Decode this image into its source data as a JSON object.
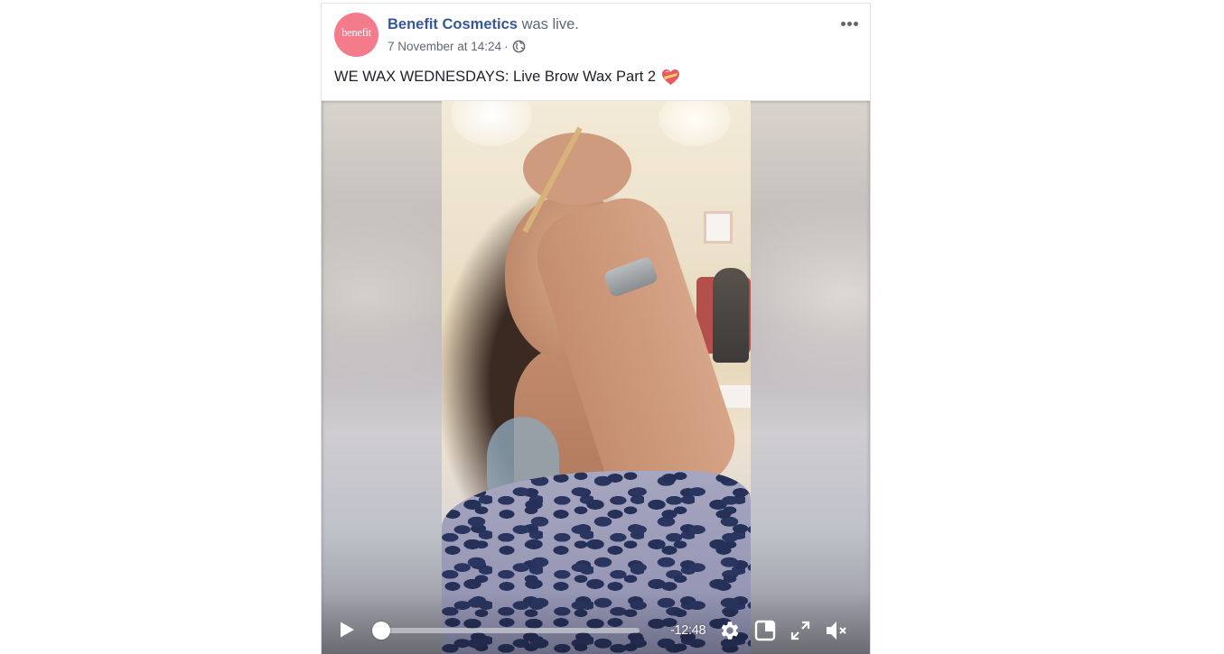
{
  "post": {
    "page_name": "Benefit Cosmetics",
    "action": "was live.",
    "timestamp": "7 November at 14:24",
    "separator": "·",
    "audience_icon": "globe-icon",
    "message": "WE WAX WEDNESDAYS: Live Brow Wax Part 2",
    "message_emoji": "heart-with-ribbon-icon",
    "avatar_logo": "benefit",
    "avatar_color": "#f47b8a",
    "link_color": "#365899"
  },
  "video": {
    "time_remaining": "-12:48",
    "progress_fraction": 0.0,
    "controls": [
      "play-icon",
      "gear-icon",
      "picture-in-picture-icon",
      "fullscreen-icon",
      "muted-speaker-icon"
    ]
  }
}
